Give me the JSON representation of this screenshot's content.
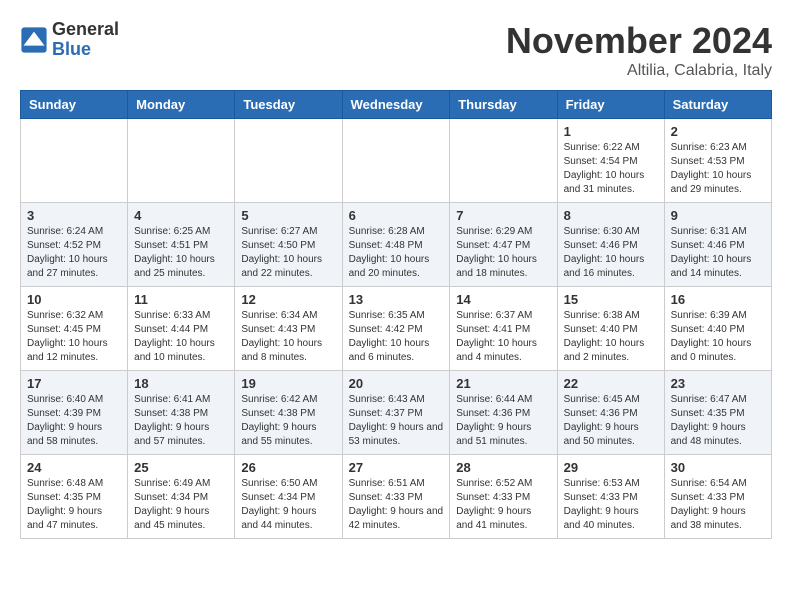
{
  "logo": {
    "text_general": "General",
    "text_blue": "Blue"
  },
  "title": "November 2024",
  "subtitle": "Altilia, Calabria, Italy",
  "days_of_week": [
    "Sunday",
    "Monday",
    "Tuesday",
    "Wednesday",
    "Thursday",
    "Friday",
    "Saturday"
  ],
  "weeks": [
    [
      {
        "day": "",
        "info": ""
      },
      {
        "day": "",
        "info": ""
      },
      {
        "day": "",
        "info": ""
      },
      {
        "day": "",
        "info": ""
      },
      {
        "day": "",
        "info": ""
      },
      {
        "day": "1",
        "info": "Sunrise: 6:22 AM\nSunset: 4:54 PM\nDaylight: 10 hours and 31 minutes."
      },
      {
        "day": "2",
        "info": "Sunrise: 6:23 AM\nSunset: 4:53 PM\nDaylight: 10 hours and 29 minutes."
      }
    ],
    [
      {
        "day": "3",
        "info": "Sunrise: 6:24 AM\nSunset: 4:52 PM\nDaylight: 10 hours and 27 minutes."
      },
      {
        "day": "4",
        "info": "Sunrise: 6:25 AM\nSunset: 4:51 PM\nDaylight: 10 hours and 25 minutes."
      },
      {
        "day": "5",
        "info": "Sunrise: 6:27 AM\nSunset: 4:50 PM\nDaylight: 10 hours and 22 minutes."
      },
      {
        "day": "6",
        "info": "Sunrise: 6:28 AM\nSunset: 4:48 PM\nDaylight: 10 hours and 20 minutes."
      },
      {
        "day": "7",
        "info": "Sunrise: 6:29 AM\nSunset: 4:47 PM\nDaylight: 10 hours and 18 minutes."
      },
      {
        "day": "8",
        "info": "Sunrise: 6:30 AM\nSunset: 4:46 PM\nDaylight: 10 hours and 16 minutes."
      },
      {
        "day": "9",
        "info": "Sunrise: 6:31 AM\nSunset: 4:46 PM\nDaylight: 10 hours and 14 minutes."
      }
    ],
    [
      {
        "day": "10",
        "info": "Sunrise: 6:32 AM\nSunset: 4:45 PM\nDaylight: 10 hours and 12 minutes."
      },
      {
        "day": "11",
        "info": "Sunrise: 6:33 AM\nSunset: 4:44 PM\nDaylight: 10 hours and 10 minutes."
      },
      {
        "day": "12",
        "info": "Sunrise: 6:34 AM\nSunset: 4:43 PM\nDaylight: 10 hours and 8 minutes."
      },
      {
        "day": "13",
        "info": "Sunrise: 6:35 AM\nSunset: 4:42 PM\nDaylight: 10 hours and 6 minutes."
      },
      {
        "day": "14",
        "info": "Sunrise: 6:37 AM\nSunset: 4:41 PM\nDaylight: 10 hours and 4 minutes."
      },
      {
        "day": "15",
        "info": "Sunrise: 6:38 AM\nSunset: 4:40 PM\nDaylight: 10 hours and 2 minutes."
      },
      {
        "day": "16",
        "info": "Sunrise: 6:39 AM\nSunset: 4:40 PM\nDaylight: 10 hours and 0 minutes."
      }
    ],
    [
      {
        "day": "17",
        "info": "Sunrise: 6:40 AM\nSunset: 4:39 PM\nDaylight: 9 hours and 58 minutes."
      },
      {
        "day": "18",
        "info": "Sunrise: 6:41 AM\nSunset: 4:38 PM\nDaylight: 9 hours and 57 minutes."
      },
      {
        "day": "19",
        "info": "Sunrise: 6:42 AM\nSunset: 4:38 PM\nDaylight: 9 hours and 55 minutes."
      },
      {
        "day": "20",
        "info": "Sunrise: 6:43 AM\nSunset: 4:37 PM\nDaylight: 9 hours and 53 minutes."
      },
      {
        "day": "21",
        "info": "Sunrise: 6:44 AM\nSunset: 4:36 PM\nDaylight: 9 hours and 51 minutes."
      },
      {
        "day": "22",
        "info": "Sunrise: 6:45 AM\nSunset: 4:36 PM\nDaylight: 9 hours and 50 minutes."
      },
      {
        "day": "23",
        "info": "Sunrise: 6:47 AM\nSunset: 4:35 PM\nDaylight: 9 hours and 48 minutes."
      }
    ],
    [
      {
        "day": "24",
        "info": "Sunrise: 6:48 AM\nSunset: 4:35 PM\nDaylight: 9 hours and 47 minutes."
      },
      {
        "day": "25",
        "info": "Sunrise: 6:49 AM\nSunset: 4:34 PM\nDaylight: 9 hours and 45 minutes."
      },
      {
        "day": "26",
        "info": "Sunrise: 6:50 AM\nSunset: 4:34 PM\nDaylight: 9 hours and 44 minutes."
      },
      {
        "day": "27",
        "info": "Sunrise: 6:51 AM\nSunset: 4:33 PM\nDaylight: 9 hours and 42 minutes."
      },
      {
        "day": "28",
        "info": "Sunrise: 6:52 AM\nSunset: 4:33 PM\nDaylight: 9 hours and 41 minutes."
      },
      {
        "day": "29",
        "info": "Sunrise: 6:53 AM\nSunset: 4:33 PM\nDaylight: 9 hours and 40 minutes."
      },
      {
        "day": "30",
        "info": "Sunrise: 6:54 AM\nSunset: 4:33 PM\nDaylight: 9 hours and 38 minutes."
      }
    ]
  ]
}
